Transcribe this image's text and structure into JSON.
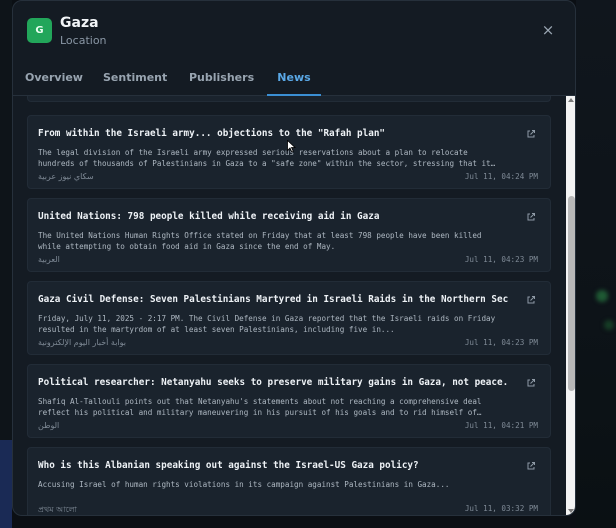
{
  "location": {
    "badge": "G",
    "title": "Gaza",
    "subtitle": "Location"
  },
  "close_icon": "×",
  "tabs": [
    {
      "label": "Overview",
      "active": false
    },
    {
      "label": "Sentiment",
      "active": false
    },
    {
      "label": "Publishers",
      "active": false
    },
    {
      "label": "News",
      "active": true
    }
  ],
  "news": [
    {
      "title": "From within the Israeli army... objections to the \"Rafah plan\"",
      "description": "The legal division of the Israeli army expressed serious reservations about a plan to relocate hundreds of thousands of Palestinians in Gaza to a \"safe zone\" within the sector, stressing that it may…",
      "source": "سكاي نيوز عربية",
      "time": "Jul 11, 04:24 PM"
    },
    {
      "title": "United Nations: 798 people killed while receiving aid in Gaza",
      "description": "The United Nations Human Rights Office stated on Friday that at least 798 people have been killed while attempting to obtain food aid in Gaza since the end of May.",
      "source": "العربية",
      "time": "Jul 11, 04:23 PM"
    },
    {
      "title": "Gaza Civil Defense: Seven Palestinians Martyred in Israeli Raids in the Northern Sector",
      "description": "Friday, July 11, 2025 - 2:17 PM. The Civil Defense in Gaza reported that the Israeli raids on Friday resulted in the martyrdom of at least seven Palestinians, including five in...",
      "source": "بوابة أخبار اليوم الإلكترونية",
      "time": "Jul 11, 04:23 PM"
    },
    {
      "title": "Political researcher: Netanyahu seeks to preserve military gains in Gaza, not peace.",
      "description": "Shafiq Al-Tallouli points out that Netanyahu's statements about not reaching a comprehensive deal reflect his political and military maneuvering in his pursuit of his goals and to rid himself of…",
      "source": "الوطن",
      "time": "Jul 11, 04:21 PM"
    },
    {
      "title": "Who is this Albanian speaking out against the Israel-US Gaza policy?",
      "description": "Accusing Israel of human rights violations in its campaign against Palestinians in Gaza...",
      "source": "প্রথম আলো",
      "time": "Jul 11, 03:32 PM"
    }
  ],
  "colors": {
    "accent": "#3b8fd4",
    "badge": "#22a65a",
    "card_bg": "#1a232d",
    "modal_bg": "#141b23"
  },
  "icons": {
    "external_link": "external-link-icon",
    "close": "close-icon"
  }
}
